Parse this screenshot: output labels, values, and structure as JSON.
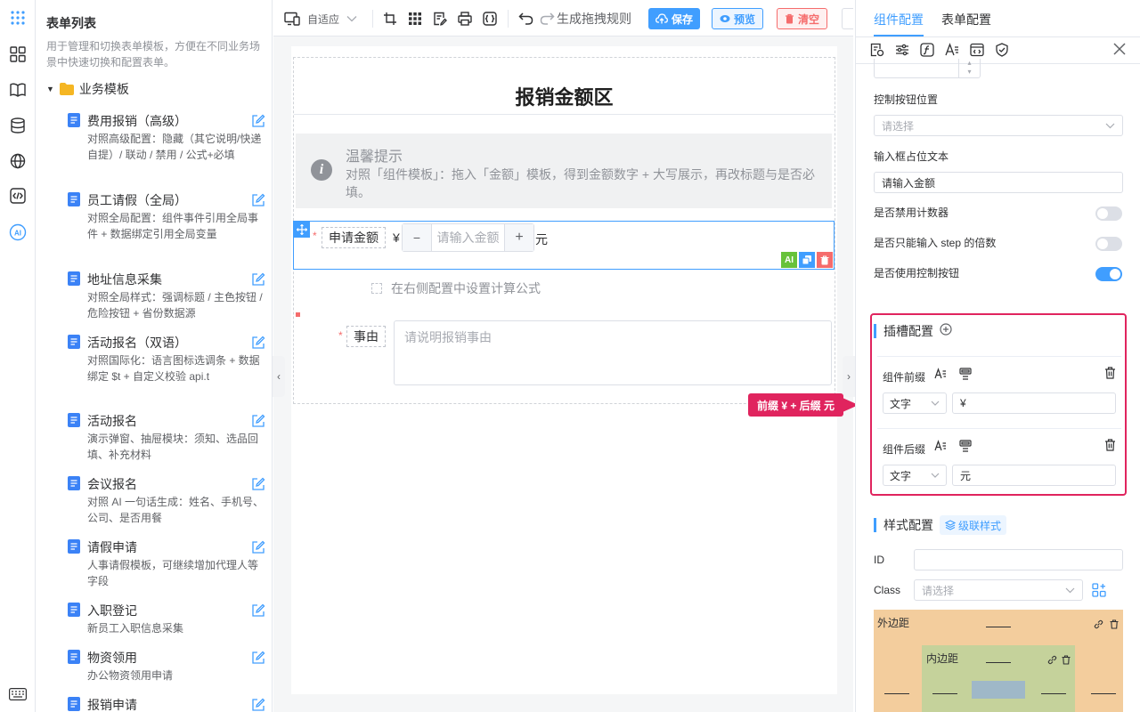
{
  "sidebar": {
    "title": "表单列表",
    "description": "用于管理和切换表单模板，方便在不同业务场景中快速切换和配置表单。",
    "group_label": "业务模板",
    "items": [
      {
        "title": "费用报销（高级）",
        "desc": "对照高级配置：隐藏（其它说明/快递自提）/ 联动 / 禁用 / 公式+必填"
      },
      {
        "title": "员工请假（全局）",
        "desc": "对照全局配置：组件事件引用全局事件 + 数据绑定引用全局变量"
      },
      {
        "title": "地址信息采集",
        "desc": "对照全局样式：强调标题 / 主色按钮 / 危险按钮 + 省份数据源"
      },
      {
        "title": "活动报名（双语）",
        "desc": "对照国际化：语言图标选调条 + 数据绑定 $t + 自定义校验 api.t"
      },
      {
        "title": "活动报名",
        "desc": "演示弹窗、抽屉模块：须知、选品回填、补充材料"
      },
      {
        "title": "会议报名",
        "desc": "对照 AI 一句话生成：姓名、手机号、公司、是否用餐"
      },
      {
        "title": "请假申请",
        "desc": "人事请假模板，可继续增加代理人等字段"
      },
      {
        "title": "入职登记",
        "desc": "新员工入职信息采集"
      },
      {
        "title": "物资领用",
        "desc": "办公物资领用申请"
      },
      {
        "title": "报销申请",
        "desc": ""
      }
    ]
  },
  "toolbar": {
    "layout_label": "自适应",
    "rules_label": "生成拖拽规则",
    "save_label": "保存",
    "preview_label": "预览",
    "clear_label": "清空"
  },
  "canvas": {
    "title": "报销金额区",
    "alert_title": "温馨提示",
    "alert_text": "对照「组件模板」：拖入「金额」模板，得到金额数字 + 大写展示，再改标题与是否必填。",
    "amount_label": "申请金额",
    "amount_prefix": "¥",
    "amount_placeholder": "请输入金额",
    "amount_suffix": "元",
    "minus": "−",
    "plus": "+",
    "formula_hint": "在右侧配置中设置计算公式",
    "reason_label": "事由",
    "reason_placeholder": "请说明报销事由",
    "required_mark": "*",
    "ai_badge": "AI"
  },
  "callout": "前缀 ¥ + 后缀 元",
  "panel": {
    "tab_component": "组件配置",
    "tab_form": "表单配置",
    "button_position_label": "控制按钮位置",
    "button_position_placeholder": "请选择",
    "placeholder_label": "输入框占位文本",
    "placeholder_value": "请输入金额",
    "disable_counter_label": "是否禁用计数器",
    "step_only_label": "是否只能输入 step 的倍数",
    "use_controls_label": "是否使用控制按钮",
    "switches": {
      "disable_counter": false,
      "step_only": false,
      "use_controls": true
    },
    "slot_title": "插槽配置",
    "prefix_label": "组件前缀",
    "prefix_type": "文字",
    "prefix_value": "¥",
    "suffix_label": "组件后缀",
    "suffix_type": "文字",
    "suffix_value": "元",
    "style_title": "样式配置",
    "cascade_label": "级联样式",
    "id_label": "ID",
    "class_label": "Class",
    "class_placeholder": "请选择",
    "margin_label": "外边距",
    "padding_label": "内边距"
  },
  "colors": {
    "accent": "#409eff",
    "danger": "#e0245e",
    "margin_bg": "#f3cd9d",
    "padding_bg": "#c5d29b"
  }
}
